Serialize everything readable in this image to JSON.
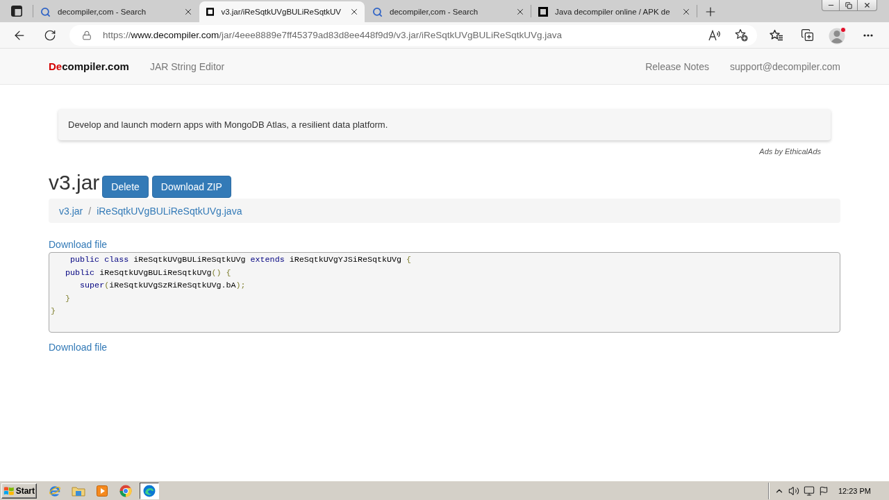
{
  "browser": {
    "tabs": [
      {
        "kind": "search",
        "title": "decompiler,com - Search",
        "selected": false
      },
      {
        "kind": "page",
        "title": "v3.jar/iReSqtkUVgBULiReSqtkUV",
        "selected": true
      },
      {
        "kind": "search",
        "title": "decompiler,com - Search",
        "selected": false
      },
      {
        "kind": "page",
        "title": "Java decompiler online / APK de",
        "selected": false
      }
    ],
    "address": {
      "scheme": "https://",
      "host": "www.decompiler.com",
      "path": "/jar/4eee8889e7ff45379ad83d8ee448f9d9/v3.jar/iReSqtkUVgBULiReSqtkUVg.java"
    }
  },
  "navbar": {
    "brand_accent": "De",
    "brand_rest": "compiler.com",
    "links": [
      "JAR String Editor"
    ],
    "right_links": [
      "Release Notes",
      "support@decompiler.com"
    ]
  },
  "ad": {
    "text": "Develop and launch modern apps with MongoDB Atlas, a resilient data platform.",
    "attribution": "Ads by EthicalAds"
  },
  "file": {
    "title": "v3.jar",
    "buttons": [
      "Delete",
      "Download ZIP"
    ],
    "breadcrumb": {
      "items": [
        "v3.jar",
        "iReSqtkUVgBULiReSqtkUVg.java"
      ],
      "separator": "/"
    },
    "download_link_top": "Download file",
    "download_link_bottom": "Download file"
  },
  "code": {
    "lines": [
      [
        {
          "kind": "keyword",
          "text": "    public class"
        },
        {
          "kind": "name",
          "text": " iReSqtkUVgBULiReSqtkUVg "
        },
        {
          "kind": "keyword",
          "text": "extends"
        },
        {
          "kind": "name",
          "text": " iReSqtkUVgYJSiReSqtkUVg "
        },
        {
          "kind": "punct",
          "text": "{"
        }
      ],
      [
        {
          "kind": "keyword",
          "text": "   public"
        },
        {
          "kind": "name",
          "text": " iReSqtkUVgBULiReSqtkUVg"
        },
        {
          "kind": "punct",
          "text": "() {"
        }
      ],
      [
        {
          "kind": "keyword",
          "text": "      super"
        },
        {
          "kind": "punct",
          "text": "("
        },
        {
          "kind": "name",
          "text": "iReSqtkUVgSzRiReSqtkUVg.bA"
        },
        {
          "kind": "punct",
          "text": ");"
        }
      ],
      [
        {
          "kind": "punct",
          "text": "   }"
        }
      ],
      [
        {
          "kind": "punct",
          "text": "}"
        }
      ]
    ]
  },
  "taskbar": {
    "start": "Start",
    "apps": [
      {
        "kind": "ie",
        "selected": false
      },
      {
        "kind": "explorer",
        "selected": false
      },
      {
        "kind": "player",
        "selected": false
      },
      {
        "kind": "chrome",
        "selected": false
      },
      {
        "kind": "edge",
        "selected": true
      }
    ],
    "clock": "12:23 PM"
  }
}
